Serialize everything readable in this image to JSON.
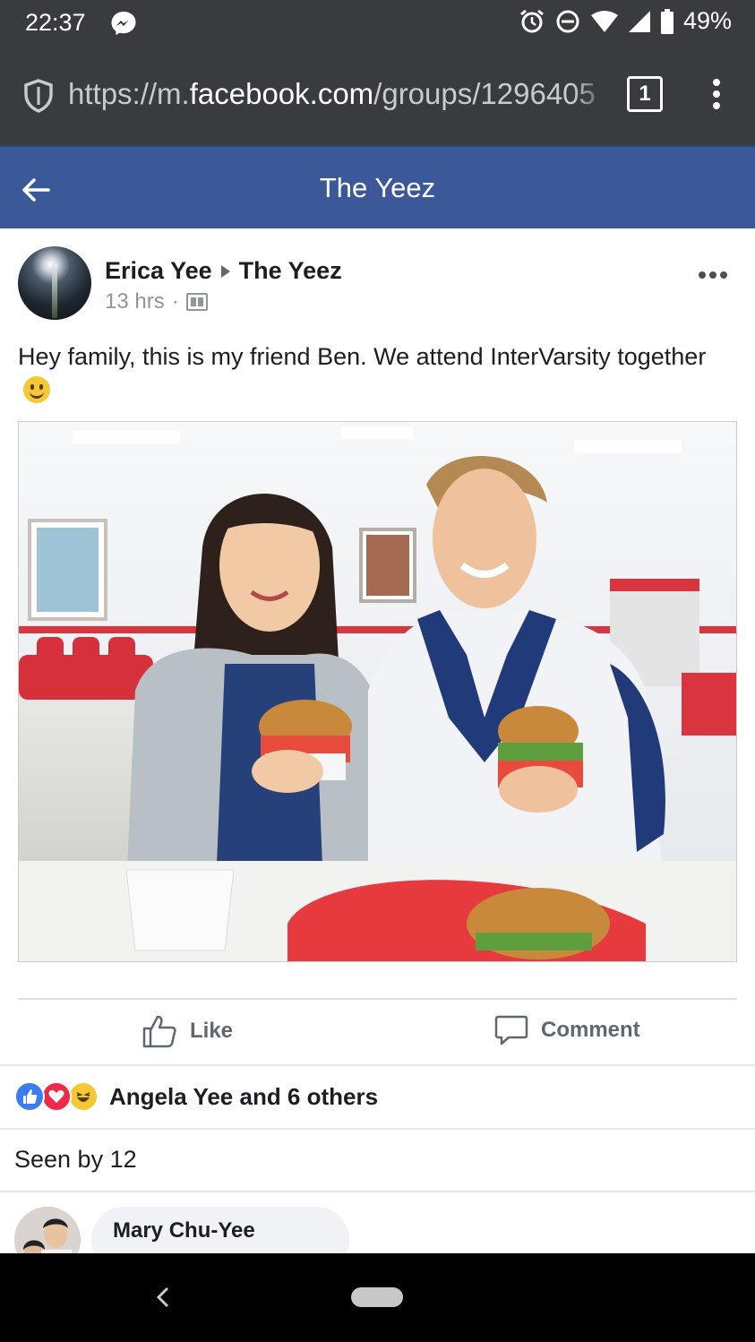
{
  "status_bar": {
    "time": "22:37",
    "battery": "49%",
    "icons": [
      "messenger-icon",
      "alarm-icon",
      "do-not-disturb-icon",
      "wifi-icon",
      "signal-icon",
      "battery-icon"
    ]
  },
  "browser": {
    "url_prefix": "https://m.",
    "url_domain": "facebook.com",
    "url_path": "/groups/1296405",
    "tab_count": "1"
  },
  "header": {
    "title": "The Yeez"
  },
  "post": {
    "author": "Erica Yee",
    "group": "The Yeez",
    "time": "13 hrs",
    "separator": "·",
    "text": "Hey family, this is my friend Ben. We attend InterVarsity together",
    "photo_alt": "Two people holding burgers at a restaurant table"
  },
  "actions": {
    "like_label": "Like",
    "comment_label": "Comment"
  },
  "reactions": {
    "summary": "Angela Yee and 6 others",
    "types": [
      "like",
      "love",
      "haha"
    ]
  },
  "seen_by": "Seen by 12",
  "comments": [
    {
      "author": "Mary Chu-Yee"
    }
  ],
  "colors": {
    "facebook_blue": "#3b5998",
    "chrome_bar": "#3a3b3e",
    "like_blue": "#3b7cf2",
    "love_red": "#f0284a",
    "haha_yellow": "#f7c833"
  }
}
